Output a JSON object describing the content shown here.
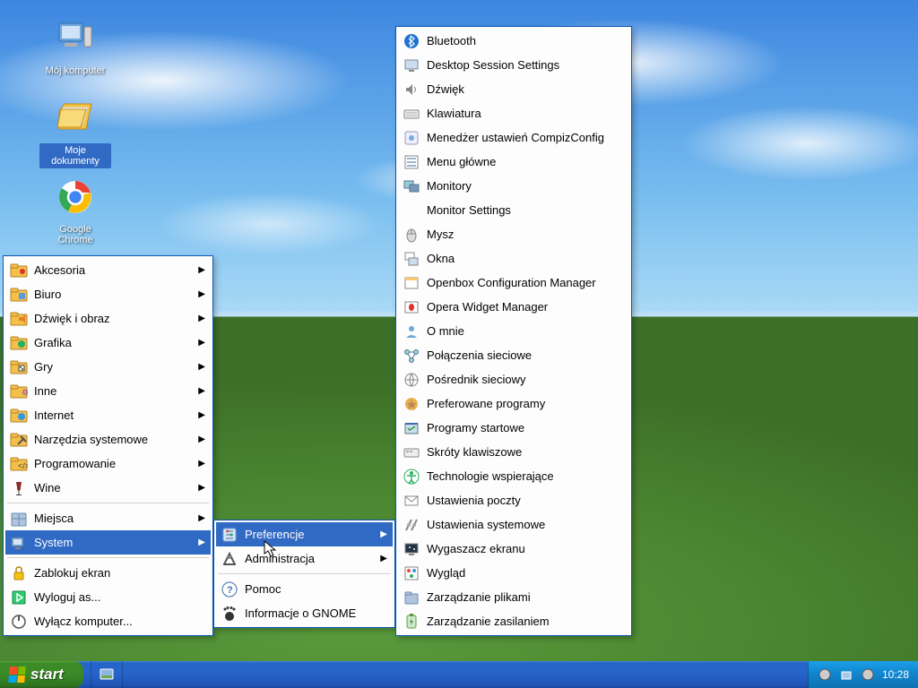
{
  "desktop_icons": [
    {
      "id": "my-computer",
      "label": "Mój komputer"
    },
    {
      "id": "my-documents",
      "label": "Moje dokumenty"
    },
    {
      "id": "google-chrome",
      "label": "Google Chrome"
    }
  ],
  "start_menu": {
    "categories": [
      {
        "id": "accessories",
        "label": "Akcesoria",
        "has_sub": true
      },
      {
        "id": "office",
        "label": "Biuro",
        "has_sub": true
      },
      {
        "id": "sound-video",
        "label": "Dźwięk i obraz",
        "has_sub": true
      },
      {
        "id": "graphics",
        "label": "Grafika",
        "has_sub": true
      },
      {
        "id": "games",
        "label": "Gry",
        "has_sub": true
      },
      {
        "id": "other",
        "label": "Inne",
        "has_sub": true
      },
      {
        "id": "internet",
        "label": "Internet",
        "has_sub": true
      },
      {
        "id": "system-tools",
        "label": "Narzędzia systemowe",
        "has_sub": true
      },
      {
        "id": "programming",
        "label": "Programowanie",
        "has_sub": true
      },
      {
        "id": "wine",
        "label": "Wine",
        "has_sub": true
      }
    ],
    "places": {
      "id": "places",
      "label": "Miejsca",
      "has_sub": true
    },
    "system": {
      "id": "system",
      "label": "System",
      "has_sub": true
    },
    "session": [
      {
        "id": "lock",
        "label": "Zablokuj ekran"
      },
      {
        "id": "logout",
        "label": "Wyloguj as..."
      },
      {
        "id": "shutdown",
        "label": "Wyłącz komputer..."
      }
    ]
  },
  "system_submenu": [
    {
      "id": "preferences",
      "label": "Preferencje",
      "has_sub": true
    },
    {
      "id": "administration",
      "label": "Administracja",
      "has_sub": true
    },
    {
      "id": "help",
      "label": "Pomoc"
    },
    {
      "id": "about-gnome",
      "label": "Informacje o GNOME"
    }
  ],
  "preferences_submenu": [
    {
      "id": "bluetooth",
      "label": "Bluetooth"
    },
    {
      "id": "desktop-session",
      "label": "Desktop Session Settings"
    },
    {
      "id": "sound",
      "label": "Dźwięk"
    },
    {
      "id": "keyboard",
      "label": "Klawiatura"
    },
    {
      "id": "compiz",
      "label": "Menedżer ustawień CompizConfig"
    },
    {
      "id": "main-menu",
      "label": "Menu główne"
    },
    {
      "id": "monitors",
      "label": "Monitory"
    },
    {
      "id": "monitor-settings",
      "label": "Monitor Settings"
    },
    {
      "id": "mouse",
      "label": "Mysz"
    },
    {
      "id": "windows",
      "label": "Okna"
    },
    {
      "id": "openbox",
      "label": "Openbox Configuration Manager"
    },
    {
      "id": "opera-widget",
      "label": "Opera Widget Manager"
    },
    {
      "id": "about-me",
      "label": "O mnie"
    },
    {
      "id": "network",
      "label": "Połączenia sieciowe"
    },
    {
      "id": "proxy",
      "label": "Pośrednik sieciowy"
    },
    {
      "id": "preferred-apps",
      "label": "Preferowane programy"
    },
    {
      "id": "startup",
      "label": "Programy startowe"
    },
    {
      "id": "shortcuts",
      "label": "Skróty klawiszowe"
    },
    {
      "id": "assistive",
      "label": "Technologie wspierające"
    },
    {
      "id": "mail",
      "label": "Ustawienia poczty"
    },
    {
      "id": "system-settings",
      "label": "Ustawienia systemowe"
    },
    {
      "id": "screensaver",
      "label": "Wygaszacz ekranu"
    },
    {
      "id": "appearance",
      "label": "Wygląd"
    },
    {
      "id": "file-mgmt",
      "label": "Zarządzanie plikami"
    },
    {
      "id": "power",
      "label": "Zarządzanie zasilaniem"
    }
  ],
  "taskbar": {
    "start_label": "start",
    "clock": "10:28"
  }
}
